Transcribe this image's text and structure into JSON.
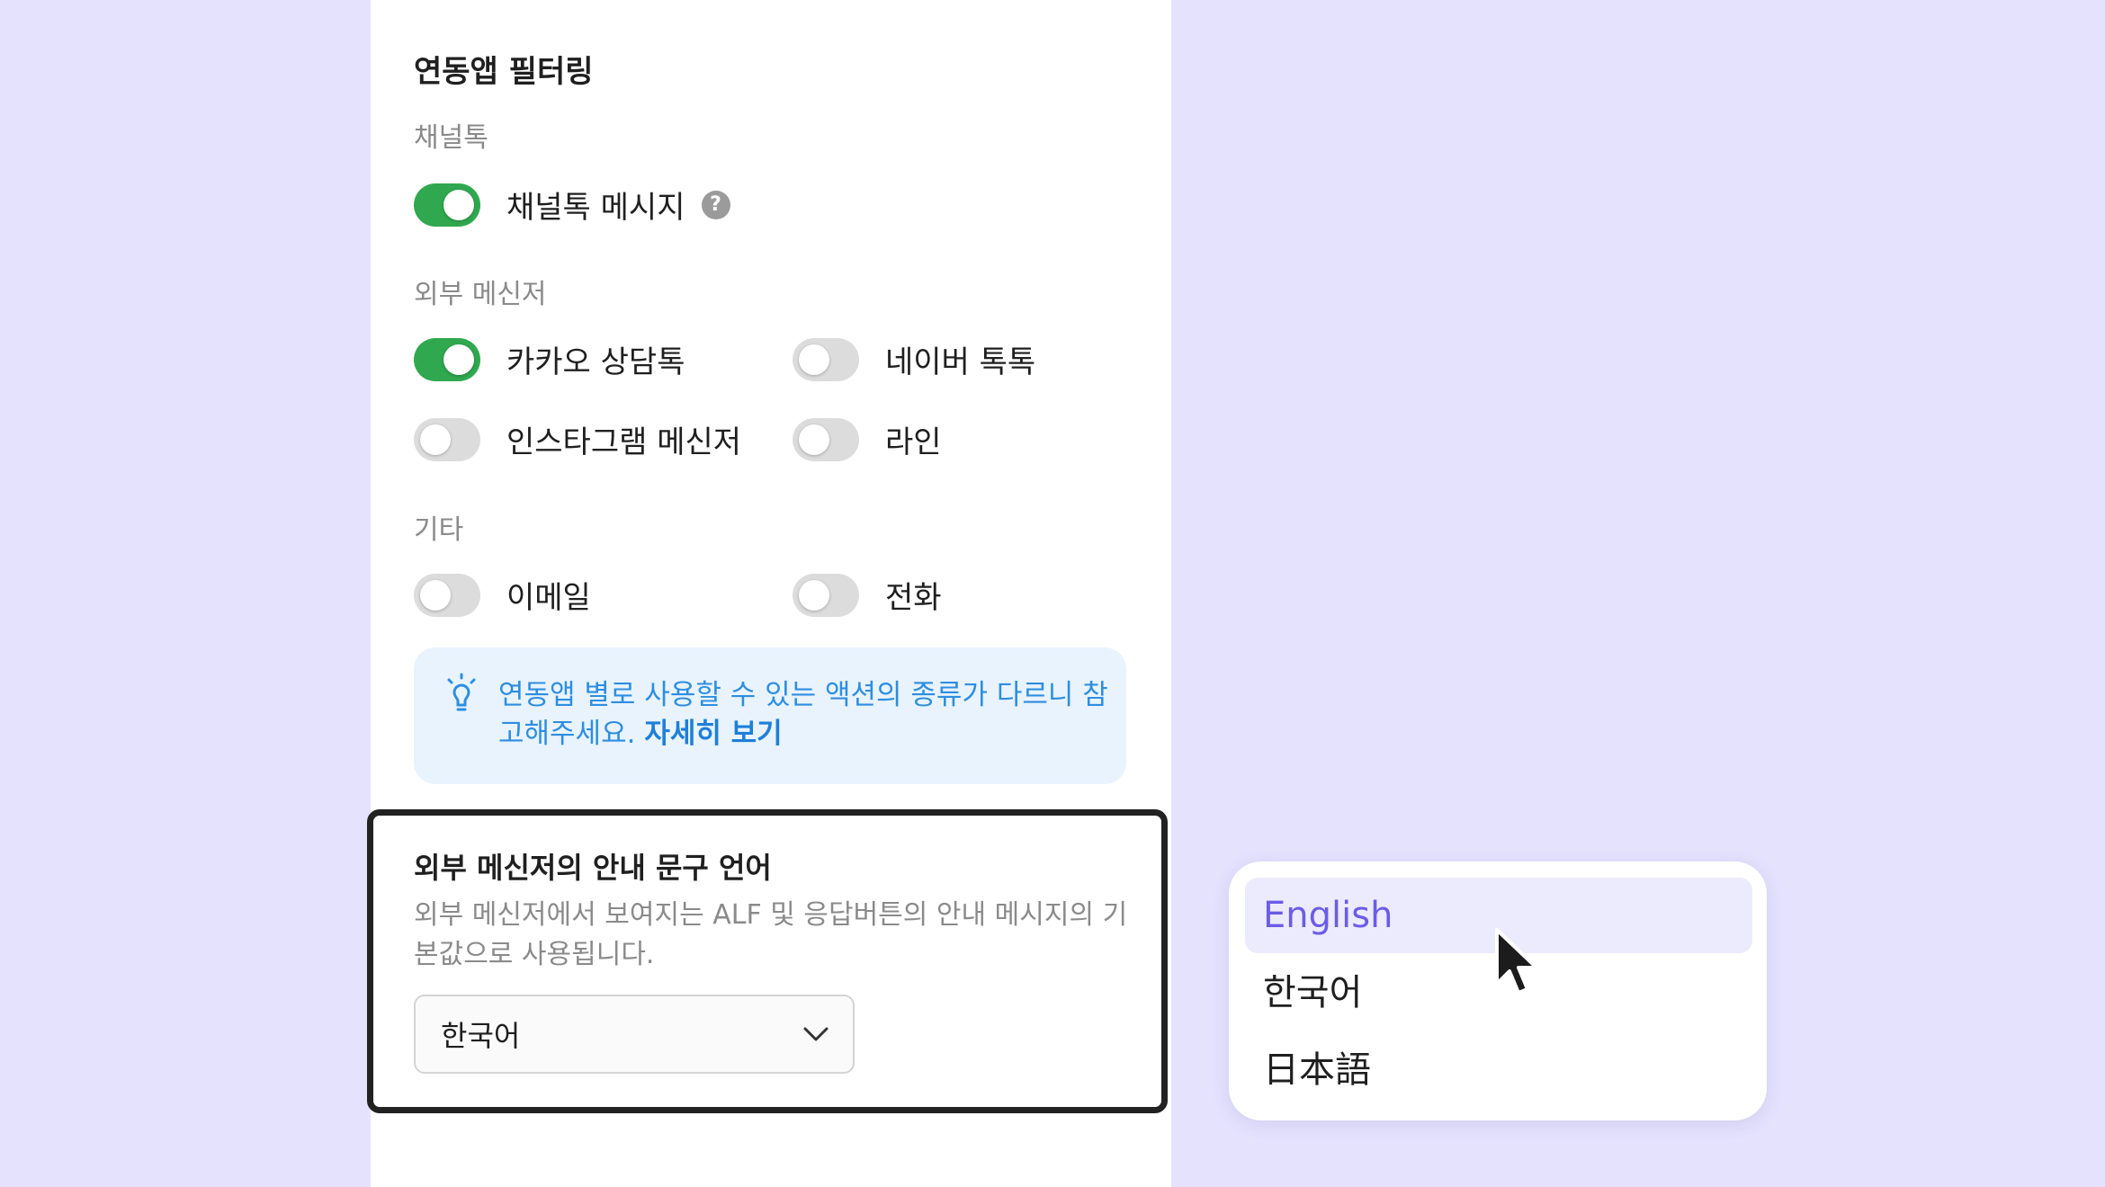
{
  "filtering": {
    "title": "연동앱 필터링",
    "groups": {
      "channeltalk": {
        "label": "채널톡",
        "toggles": [
          {
            "label": "채널톡 메시지",
            "on": true,
            "help": "?"
          }
        ]
      },
      "external": {
        "label": "외부 메신저",
        "toggles": [
          {
            "label": "카카오 상담톡",
            "on": true
          },
          {
            "label": "네이버 톡톡",
            "on": false
          },
          {
            "label": "인스타그램 메신저",
            "on": false
          },
          {
            "label": "라인",
            "on": false
          }
        ]
      },
      "other": {
        "label": "기타",
        "toggles": [
          {
            "label": "이메일",
            "on": false
          },
          {
            "label": "전화",
            "on": false
          }
        ]
      }
    },
    "info": {
      "text": "연동앱 별로 사용할 수 있는 액션의 종류가 다르니 참고해주세요. ",
      "link": "자세히 보기",
      "icon": "lightbulb-icon"
    }
  },
  "language": {
    "title": "외부 메신저의 안내 문구 언어",
    "description": "외부 메신저에서 보여지는 ALF 및 응답버튼의 안내 메시지의 기본값으로 사용됩니다.",
    "selected": "한국어",
    "options": [
      "English",
      "한국어",
      "日本語"
    ],
    "highlighted": "English"
  },
  "colors": {
    "background": "#e4e2fd",
    "toggle_on": "#2fa84f",
    "toggle_off": "#dcdcdc",
    "info_bg": "#e8f3fe",
    "info_text": "#2d8ee0",
    "highlight_text": "#6b5ce7"
  }
}
